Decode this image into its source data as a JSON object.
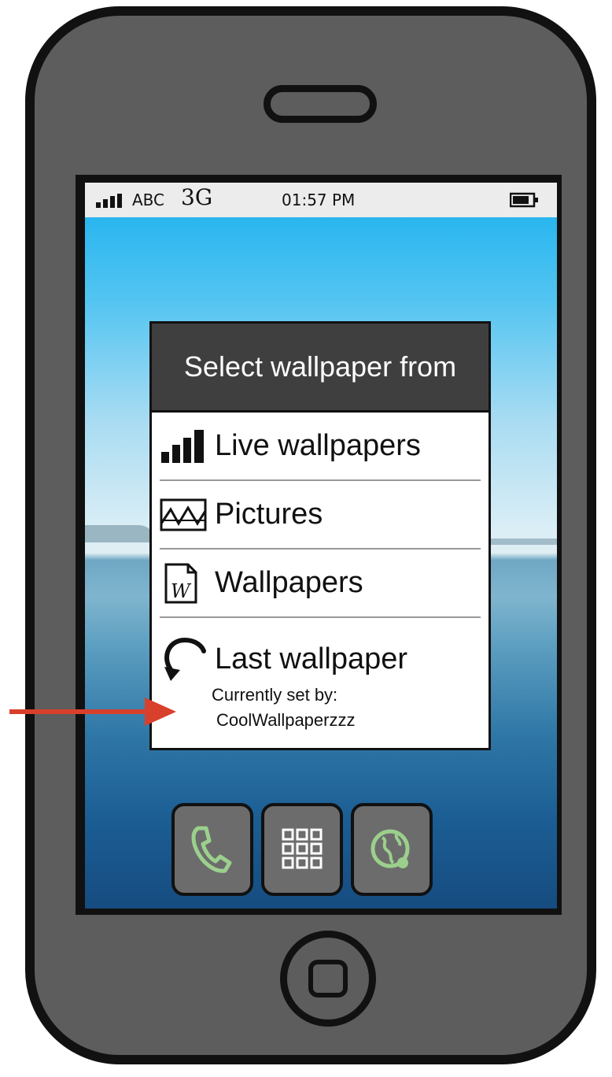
{
  "status_bar": {
    "carrier": "ABC",
    "network": "3G",
    "time": "01:57 PM"
  },
  "dialog": {
    "title": "Select wallpaper from",
    "items": [
      {
        "label": "Live wallpapers",
        "icon": "signal-bars-icon"
      },
      {
        "label": "Pictures",
        "icon": "picture-icon"
      },
      {
        "label": "Wallpapers",
        "icon": "document-icon"
      },
      {
        "label": "Last wallpaper",
        "icon": "undo-icon",
        "sub_lines": [
          "Currently set by:",
          "CoolWallpaperzzz"
        ]
      }
    ]
  },
  "dock": [
    {
      "icon": "phone-icon"
    },
    {
      "icon": "app-grid-icon"
    },
    {
      "icon": "globe-icon"
    }
  ],
  "colors": {
    "phone_body": "#5d5d5d",
    "dialog_header": "#3f3f3f",
    "accent_green": "#9bd08c",
    "arrow_red": "#d9402c"
  }
}
